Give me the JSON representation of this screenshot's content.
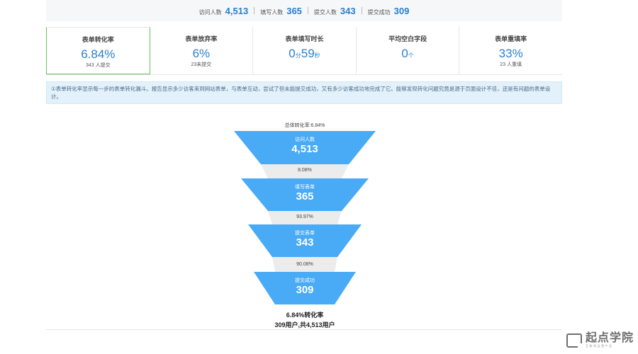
{
  "top_bar": {
    "stats": [
      {
        "label": "访问人数",
        "value": "4,513"
      },
      {
        "label": "填写人数",
        "value": "365"
      },
      {
        "label": "提交人数",
        "value": "343"
      },
      {
        "label": "提交成功",
        "value": "309"
      }
    ]
  },
  "cards": [
    {
      "label": "表单转化率",
      "value": "6.84%",
      "sub": "343 人提交"
    },
    {
      "label": "表单放弃率",
      "value": "6%",
      "sub": "23未提交"
    },
    {
      "label": "表单填写时长",
      "value_parts": [
        "0",
        "分",
        "59",
        "秒"
      ],
      "sub": ""
    },
    {
      "label": "平均空白字段",
      "value_parts": [
        "0",
        "个"
      ],
      "sub": ""
    },
    {
      "label": "表单重填率",
      "value": "33%",
      "sub": "23 人重填"
    }
  ],
  "info_text": "①表单转化率显示每一步的表单转化漏斗。报告显示多少访客来到网站表单，与表单互动，尝试了但未能提交成功，又有多少访客成功地完成了它。能够发现转化问题究竟是源于页面设计不佳，还是有问题的表单设计。",
  "funnel": {
    "title": "总体转化率:6.84%",
    "stages": [
      {
        "name": "访问人数",
        "value": "4,513"
      },
      {
        "name": "填写表单",
        "value": "365"
      },
      {
        "name": "提交表单",
        "value": "343"
      },
      {
        "name": "提交成功",
        "value": "309"
      }
    ],
    "rates": [
      "8.08%",
      "93.97%",
      "90.08%"
    ],
    "summary_rate": "6.84%转化率",
    "summary_users": "309用户,共4,513用户"
  },
  "logo": {
    "name": "起点学院",
    "sub": "互联网运营产品"
  },
  "colors": {
    "accent": "#2a7fd1",
    "funnel": "#49aaf5",
    "active_card": "#6cbf5f",
    "banner": "#e3f1fb"
  }
}
